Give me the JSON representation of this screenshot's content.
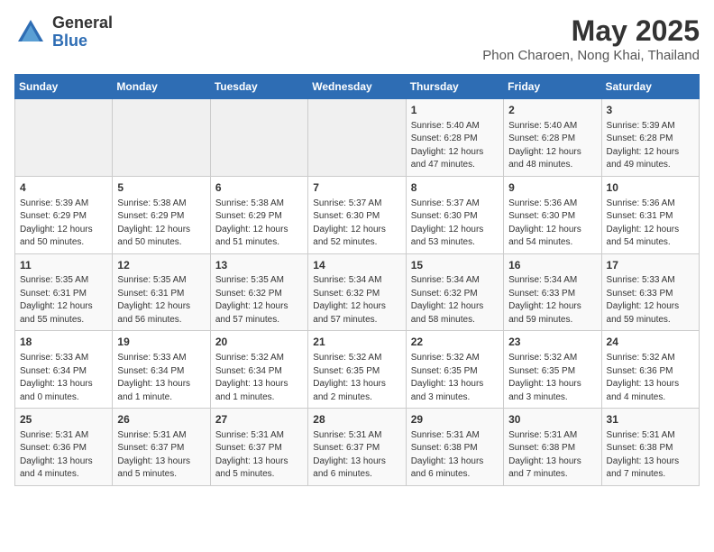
{
  "logo": {
    "general": "General",
    "blue": "Blue"
  },
  "title": "May 2025",
  "subtitle": "Phon Charoen, Nong Khai, Thailand",
  "headers": [
    "Sunday",
    "Monday",
    "Tuesday",
    "Wednesday",
    "Thursday",
    "Friday",
    "Saturday"
  ],
  "weeks": [
    [
      {
        "day": "",
        "info": ""
      },
      {
        "day": "",
        "info": ""
      },
      {
        "day": "",
        "info": ""
      },
      {
        "day": "",
        "info": ""
      },
      {
        "day": "1",
        "info": "Sunrise: 5:40 AM\nSunset: 6:28 PM\nDaylight: 12 hours\nand 47 minutes."
      },
      {
        "day": "2",
        "info": "Sunrise: 5:40 AM\nSunset: 6:28 PM\nDaylight: 12 hours\nand 48 minutes."
      },
      {
        "day": "3",
        "info": "Sunrise: 5:39 AM\nSunset: 6:28 PM\nDaylight: 12 hours\nand 49 minutes."
      }
    ],
    [
      {
        "day": "4",
        "info": "Sunrise: 5:39 AM\nSunset: 6:29 PM\nDaylight: 12 hours\nand 50 minutes."
      },
      {
        "day": "5",
        "info": "Sunrise: 5:38 AM\nSunset: 6:29 PM\nDaylight: 12 hours\nand 50 minutes."
      },
      {
        "day": "6",
        "info": "Sunrise: 5:38 AM\nSunset: 6:29 PM\nDaylight: 12 hours\nand 51 minutes."
      },
      {
        "day": "7",
        "info": "Sunrise: 5:37 AM\nSunset: 6:30 PM\nDaylight: 12 hours\nand 52 minutes."
      },
      {
        "day": "8",
        "info": "Sunrise: 5:37 AM\nSunset: 6:30 PM\nDaylight: 12 hours\nand 53 minutes."
      },
      {
        "day": "9",
        "info": "Sunrise: 5:36 AM\nSunset: 6:30 PM\nDaylight: 12 hours\nand 54 minutes."
      },
      {
        "day": "10",
        "info": "Sunrise: 5:36 AM\nSunset: 6:31 PM\nDaylight: 12 hours\nand 54 minutes."
      }
    ],
    [
      {
        "day": "11",
        "info": "Sunrise: 5:35 AM\nSunset: 6:31 PM\nDaylight: 12 hours\nand 55 minutes."
      },
      {
        "day": "12",
        "info": "Sunrise: 5:35 AM\nSunset: 6:31 PM\nDaylight: 12 hours\nand 56 minutes."
      },
      {
        "day": "13",
        "info": "Sunrise: 5:35 AM\nSunset: 6:32 PM\nDaylight: 12 hours\nand 57 minutes."
      },
      {
        "day": "14",
        "info": "Sunrise: 5:34 AM\nSunset: 6:32 PM\nDaylight: 12 hours\nand 57 minutes."
      },
      {
        "day": "15",
        "info": "Sunrise: 5:34 AM\nSunset: 6:32 PM\nDaylight: 12 hours\nand 58 minutes."
      },
      {
        "day": "16",
        "info": "Sunrise: 5:34 AM\nSunset: 6:33 PM\nDaylight: 12 hours\nand 59 minutes."
      },
      {
        "day": "17",
        "info": "Sunrise: 5:33 AM\nSunset: 6:33 PM\nDaylight: 12 hours\nand 59 minutes."
      }
    ],
    [
      {
        "day": "18",
        "info": "Sunrise: 5:33 AM\nSunset: 6:34 PM\nDaylight: 13 hours\nand 0 minutes."
      },
      {
        "day": "19",
        "info": "Sunrise: 5:33 AM\nSunset: 6:34 PM\nDaylight: 13 hours\nand 1 minute."
      },
      {
        "day": "20",
        "info": "Sunrise: 5:32 AM\nSunset: 6:34 PM\nDaylight: 13 hours\nand 1 minutes."
      },
      {
        "day": "21",
        "info": "Sunrise: 5:32 AM\nSunset: 6:35 PM\nDaylight: 13 hours\nand 2 minutes."
      },
      {
        "day": "22",
        "info": "Sunrise: 5:32 AM\nSunset: 6:35 PM\nDaylight: 13 hours\nand 3 minutes."
      },
      {
        "day": "23",
        "info": "Sunrise: 5:32 AM\nSunset: 6:35 PM\nDaylight: 13 hours\nand 3 minutes."
      },
      {
        "day": "24",
        "info": "Sunrise: 5:32 AM\nSunset: 6:36 PM\nDaylight: 13 hours\nand 4 minutes."
      }
    ],
    [
      {
        "day": "25",
        "info": "Sunrise: 5:31 AM\nSunset: 6:36 PM\nDaylight: 13 hours\nand 4 minutes."
      },
      {
        "day": "26",
        "info": "Sunrise: 5:31 AM\nSunset: 6:37 PM\nDaylight: 13 hours\nand 5 minutes."
      },
      {
        "day": "27",
        "info": "Sunrise: 5:31 AM\nSunset: 6:37 PM\nDaylight: 13 hours\nand 5 minutes."
      },
      {
        "day": "28",
        "info": "Sunrise: 5:31 AM\nSunset: 6:37 PM\nDaylight: 13 hours\nand 6 minutes."
      },
      {
        "day": "29",
        "info": "Sunrise: 5:31 AM\nSunset: 6:38 PM\nDaylight: 13 hours\nand 6 minutes."
      },
      {
        "day": "30",
        "info": "Sunrise: 5:31 AM\nSunset: 6:38 PM\nDaylight: 13 hours\nand 7 minutes."
      },
      {
        "day": "31",
        "info": "Sunrise: 5:31 AM\nSunset: 6:38 PM\nDaylight: 13 hours\nand 7 minutes."
      }
    ]
  ]
}
